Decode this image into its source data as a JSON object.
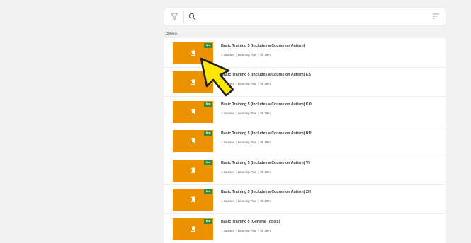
{
  "search": {
    "placeholder": "",
    "value": ""
  },
  "results": {
    "count_label": "12 items"
  },
  "items": [
    {
      "title": "Basic Training 5 (Includes a Course on Autism)",
      "courses": "4 courses",
      "type": "Learning Plan",
      "duration": "9h 39m",
      "badge": "New"
    },
    {
      "title": "Basic Training 5 (Includes a Course on Autism) ES",
      "courses": "4 courses",
      "type": "Learning Plan",
      "duration": "9h 39m",
      "badge": "New"
    },
    {
      "title": "Basic Training 5 (Includes a Course on Autism) KO",
      "courses": "4 courses",
      "type": "Learning Plan",
      "duration": "9h 39m",
      "badge": "New"
    },
    {
      "title": "Basic Training 5 (Includes a Course on Autism) RU",
      "courses": "4 courses",
      "type": "Learning Plan",
      "duration": "9h 39m",
      "badge": "New"
    },
    {
      "title": "Basic Training 5 (Includes a Course on Autism) VI",
      "courses": "4 courses",
      "type": "Learning Plan",
      "duration": "9h 39m",
      "badge": "New"
    },
    {
      "title": "Basic Training 5 (Includes a Course on Autism) ZH",
      "courses": "4 courses",
      "type": "Learning Plan",
      "duration": "9h 39m",
      "badge": "New"
    },
    {
      "title": "Basic Training 5 (General Topics)",
      "courses": "7 courses",
      "type": "Learning Plan",
      "duration": "9h 39m",
      "badge": "New"
    }
  ],
  "icons": {
    "filter": "filter-icon",
    "search": "search-icon",
    "sort": "sort-icon",
    "thumbnail": "learning-plan-icon",
    "pointer": "cursor-arrow-icon"
  },
  "colors": {
    "thumbnail": "#ec9200",
    "badge": "#3a8c3a",
    "cursor_fill": "#ffe600"
  }
}
